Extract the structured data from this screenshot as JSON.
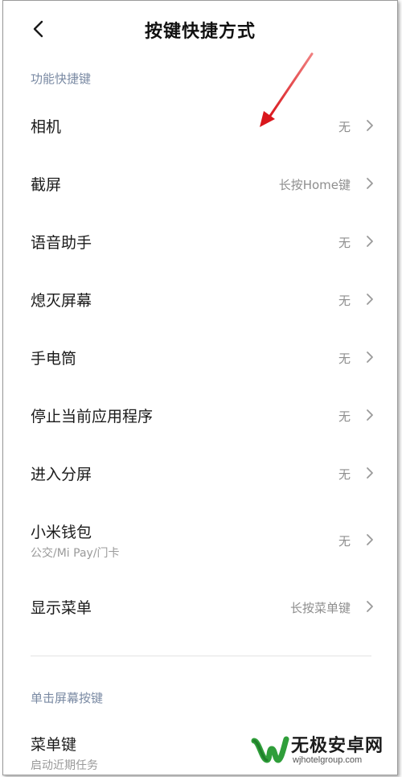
{
  "header": {
    "title": "按键快捷方式",
    "back_icon": "chevron-left-icon"
  },
  "sections": [
    {
      "label": "功能快捷键",
      "items": [
        {
          "label": "相机",
          "value": "无"
        },
        {
          "label": "截屏",
          "value": "长按Home键"
        },
        {
          "label": "语音助手",
          "value": "无"
        },
        {
          "label": "熄灭屏幕",
          "value": "无"
        },
        {
          "label": "手电筒",
          "value": "无"
        },
        {
          "label": "停止当前应用程序",
          "value": "无"
        },
        {
          "label": "进入分屏",
          "value": "无"
        },
        {
          "label": "小米钱包",
          "sublabel": "公交/Mi Pay/门卡",
          "value": "无"
        },
        {
          "label": "显示菜单",
          "value": "长按菜单键"
        }
      ]
    },
    {
      "label": "单击屏幕按键",
      "items": [
        {
          "label": "菜单键",
          "sublabel": "启动近期任务"
        }
      ]
    }
  ],
  "watermark": {
    "text": "无极安卓网",
    "url": "wjhotelgroup.com"
  },
  "colors": {
    "section_label": "#7a8aa3",
    "value_text": "#8e8e8e",
    "annotation_arrow": "#d9161c"
  }
}
